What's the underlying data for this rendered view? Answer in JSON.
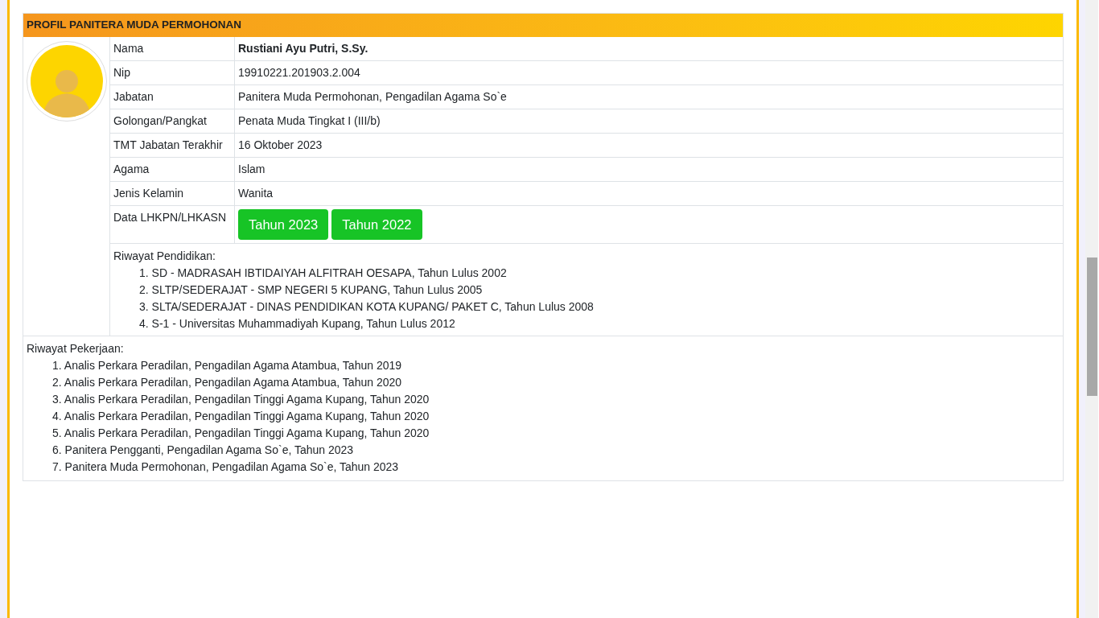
{
  "panel": {
    "title": "PROFIL PANITERA MUDA PERMOHONAN"
  },
  "fields": [
    {
      "kind": "name",
      "label": "Nama",
      "value": "Rustiani Ayu Putri, S.Sy."
    },
    {
      "kind": "text",
      "label": "Nip",
      "value": "19910221.201903.2.004"
    },
    {
      "kind": "text",
      "label": "Jabatan",
      "value": "Panitera Muda Permohonan, Pengadilan Agama So`e"
    },
    {
      "kind": "text",
      "label": "Golongan/Pangkat",
      "value": "Penata Muda Tingkat I (III/b)"
    },
    {
      "kind": "text",
      "label": "TMT Jabatan Terakhir",
      "value": "16 Oktober 2023"
    },
    {
      "kind": "text",
      "label": "Agama",
      "value": "Islam"
    },
    {
      "kind": "text",
      "label": "Jenis Kelamin",
      "value": "Wanita"
    },
    {
      "kind": "buttons",
      "label": "Data LHKPN/LHKASN",
      "buttons": [
        "Tahun 2023",
        "Tahun 2022"
      ]
    }
  ],
  "education": {
    "heading": "Riwayat Pendidikan:",
    "items": [
      "1. SD - MADRASAH IBTIDAIYAH ALFITRAH OESAPA, Tahun Lulus 2002",
      "2. SLTP/SEDERAJAT - SMP NEGERI 5 KUPANG, Tahun Lulus 2005",
      "3. SLTA/SEDERAJAT - DINAS PENDIDIKAN KOTA KUPANG/ PAKET C, Tahun Lulus 2008",
      "4. S-1 - Universitas Muhammadiyah Kupang, Tahun Lulus 2012"
    ]
  },
  "work": {
    "heading": "Riwayat Pekerjaan:",
    "items": [
      "1. Analis Perkara Peradilan, Pengadilan Agama Atambua, Tahun 2019",
      "2. Analis Perkara Peradilan, Pengadilan Agama Atambua, Tahun 2020",
      "3. Analis Perkara Peradilan, Pengadilan Tinggi Agama Kupang, Tahun 2020",
      "4. Analis Perkara Peradilan, Pengadilan Tinggi Agama Kupang, Tahun 2020",
      "5. Analis Perkara Peradilan, Pengadilan Tinggi Agama Kupang, Tahun 2020",
      "6. Panitera Pengganti, Pengadilan Agama So`e, Tahun 2023",
      "7. Panitera Muda Permohonan, Pengadilan Agama So`e, Tahun 2023"
    ]
  }
}
